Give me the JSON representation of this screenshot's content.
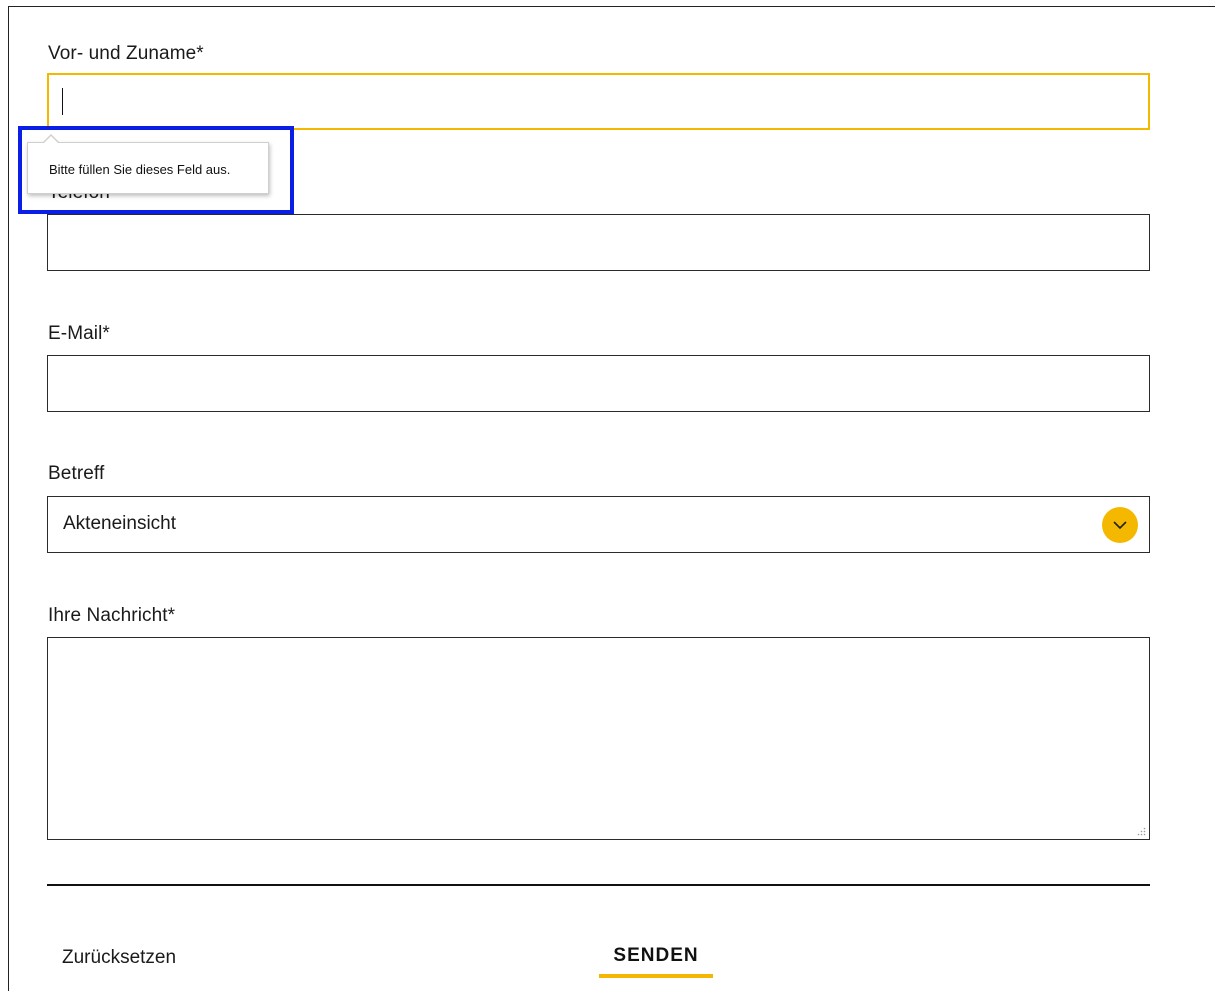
{
  "form": {
    "name_label": "Vor- und Zuname*",
    "name_value": "",
    "phone_label": "Telefon*",
    "phone_value": "",
    "email_label": "E-Mail*",
    "email_value": "",
    "subject_label": "Betreff",
    "subject_selected": "Akteneinsicht",
    "message_label": "Ihre Nachricht*",
    "message_value": "",
    "reset_label": "Zurücksetzen",
    "submit_label": "SENDEN"
  },
  "validation": {
    "tooltip_text": "Bitte füllen Sie dieses Feld aus."
  },
  "colors": {
    "accent": "#f5b800",
    "highlight": "#0a1ee6",
    "border": "#2b2b2b"
  },
  "icons": {
    "select_toggle": "chevron-down-icon",
    "textarea_resize": "resize-grip-icon"
  }
}
